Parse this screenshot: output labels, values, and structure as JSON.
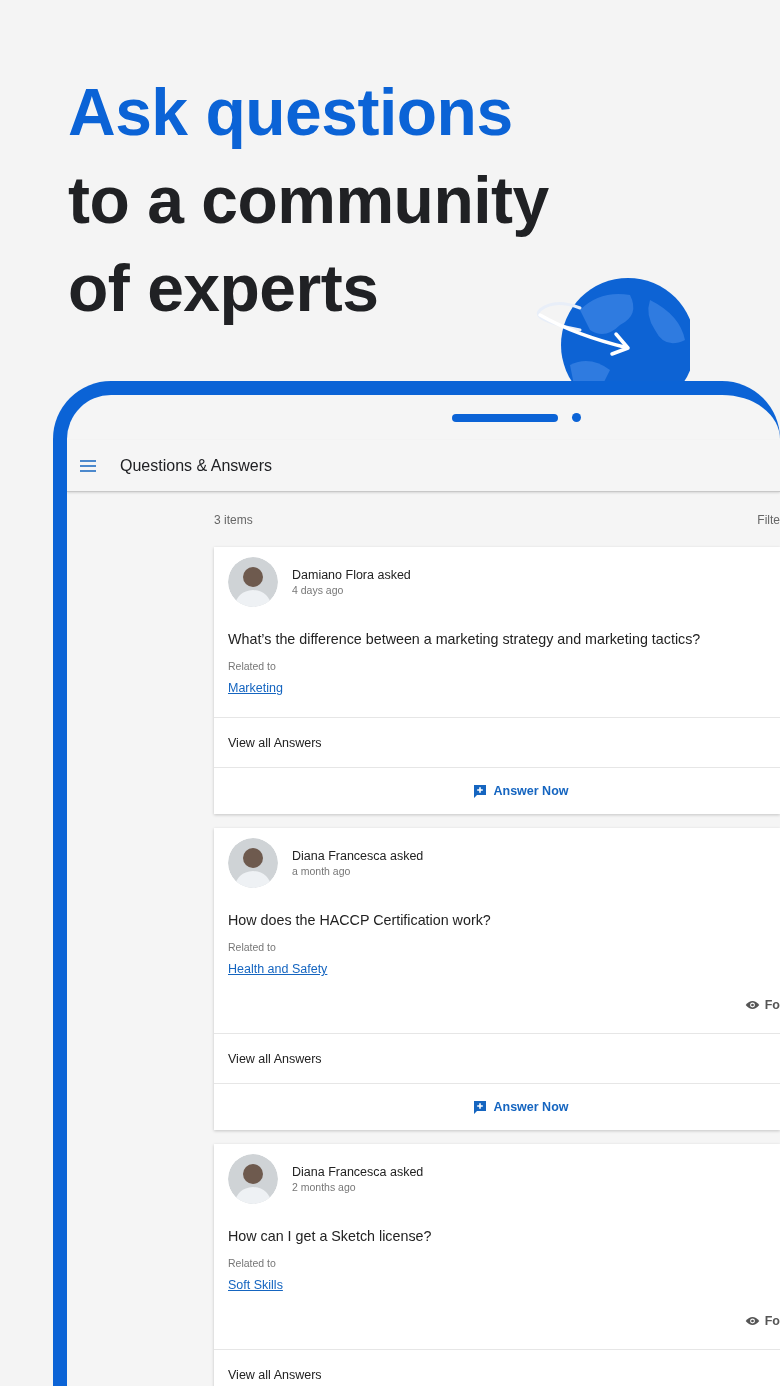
{
  "headline": {
    "accent": "Ask questions",
    "lines": [
      "to a community",
      "of experts"
    ]
  },
  "app_bar": {
    "title": "Questions & Answers"
  },
  "list_header": {
    "count": "3 items",
    "filter_label": "Filte"
  },
  "questions": [
    {
      "author": "Damiano Flora asked",
      "time": "4 days ago",
      "question": "What’s the difference between a marketing strategy and marketing tactics?",
      "related_label": "Related to",
      "topic": "Marketing",
      "view_answers": "View all Answers",
      "answer_label": "Answer Now"
    },
    {
      "author": "Diana Francesca asked",
      "time": "a month ago",
      "question": "How does the HACCP Certification work?",
      "related_label": "Related to",
      "topic": "Health and Safety",
      "follow_label": "Fo",
      "view_answers": "View all Answers",
      "answer_label": "Answer Now"
    },
    {
      "author": "Diana Francesca asked",
      "time": "2 months ago",
      "question": "How can I get a Sketch license?",
      "related_label": "Related to",
      "topic": "Soft Skills",
      "follow_label": "Fo",
      "view_answers": "View all Answers"
    }
  ]
}
